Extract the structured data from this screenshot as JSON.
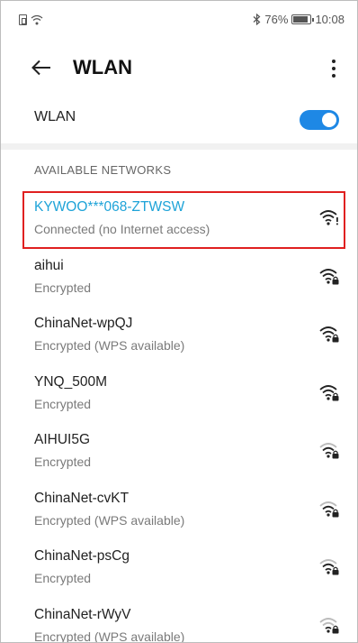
{
  "status_bar": {
    "bluetooth_icon": "bluetooth-icon",
    "battery_percent": "76%",
    "time": "10:08"
  },
  "header": {
    "title": "WLAN"
  },
  "wlan": {
    "label": "WLAN",
    "enabled": true,
    "accent": "#1e88e5"
  },
  "section": {
    "available_header": "AVAILABLE NETWORKS"
  },
  "networks": [
    {
      "name": "KYWOO***068-ZTWSW",
      "status": "Connected (no Internet access)",
      "connected": true,
      "icon": "wifi-no-internet-icon"
    },
    {
      "name": "aihui",
      "status": "Encrypted",
      "icon": "wifi-lock-icon"
    },
    {
      "name": "ChinaNet-wpQJ",
      "status": "Encrypted (WPS available)",
      "icon": "wifi-lock-icon"
    },
    {
      "name": "YNQ_500M",
      "status": "Encrypted",
      "icon": "wifi-lock-icon"
    },
    {
      "name": "AIHUI5G",
      "status": "Encrypted",
      "icon": "wifi-lock-icon"
    },
    {
      "name": "ChinaNet-cvKT",
      "status": "Encrypted (WPS available)",
      "icon": "wifi-lock-icon"
    },
    {
      "name": "ChinaNet-psCg",
      "status": "Encrypted",
      "icon": "wifi-lock-icon"
    },
    {
      "name": "ChinaNet-rWyV",
      "status": "Encrypted (WPS available)",
      "icon": "wifi-lock-icon"
    }
  ],
  "colors": {
    "connected_text": "#1ea3d8",
    "highlight": "#e02020"
  }
}
